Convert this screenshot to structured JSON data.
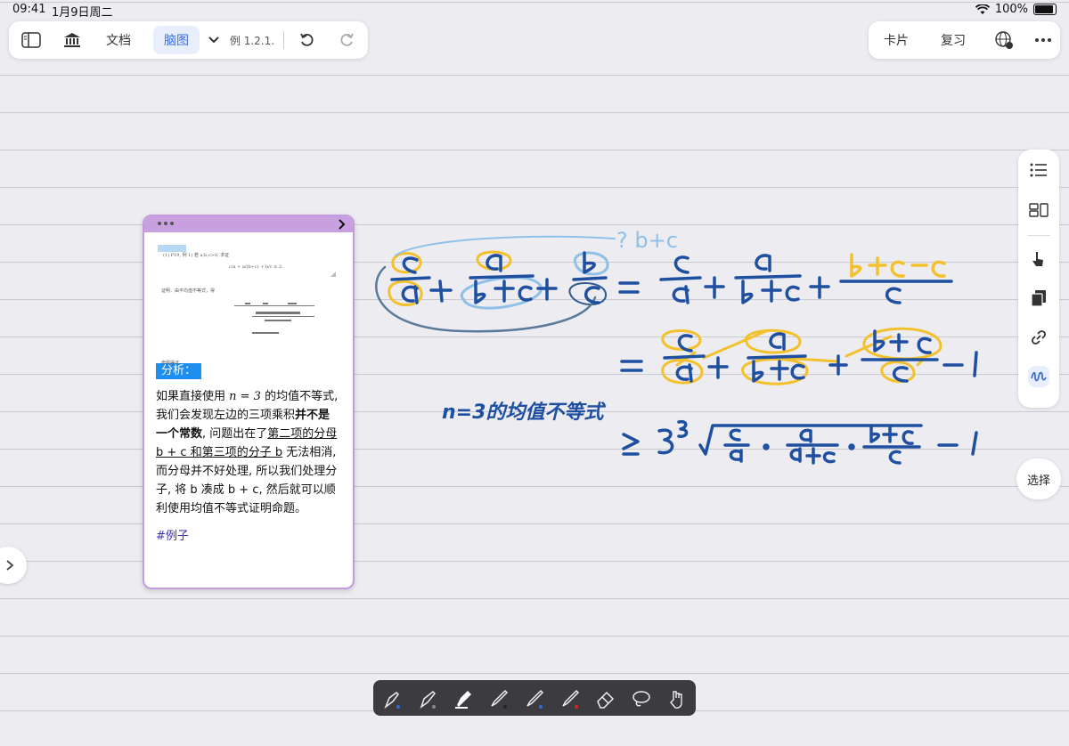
{
  "status_bar": {
    "time": "09:41",
    "date": "1月9日周二",
    "battery": "100%"
  },
  "toolbar_left": {
    "sidebar_icon": "sidebar-icon",
    "library_icon": "library-icon",
    "doc_label": "文档",
    "mindmap_label": "脑图",
    "title": "例 1.2.1.",
    "undo_icon": "undo-icon",
    "redo_icon": "redo-icon"
  },
  "toolbar_right": {
    "card_label": "卡片",
    "review_label": "复习",
    "www_icon": "www-icon",
    "more_icon": "more-icon"
  },
  "side_panel": {
    "icons": [
      "outline-icon",
      "layout-icon",
      "pointer-icon",
      "pages-icon",
      "link-icon",
      "pen-icon"
    ]
  },
  "select_label": "选择",
  "card": {
    "snippet_lines": [
      "(1) P19, 例 1) 若 a,b,c>0, 求证",
      "c/a + a/(b+c) + b/c ≥ 2.",
      "证明．由平均值不等式，得",
      "命题得证."
    ],
    "analysis_label": "分析：",
    "paragraph_runs": [
      {
        "text": "如果直接使用 ",
        "style": "normal"
      },
      {
        "text": "n = 3",
        "style": "math"
      },
      {
        "text": " 的均值不等式, 我们会发现左边的三项乘积",
        "style": "normal"
      },
      {
        "text": "并不是一个常数",
        "style": "bold"
      },
      {
        "text": ", 问题出在了",
        "style": "normal"
      },
      {
        "text": "第二项的分母 b + c 和第三项的分子 b",
        "style": "underline"
      },
      {
        "text": " 无法相消, 而分母并不好处理, 所以我们处理分子, 将 b 凑成 b + c, 然后就可以顺利使用均值不等式证明命题。",
        "style": "normal"
      }
    ],
    "tag": "#例子"
  },
  "handwriting": {
    "note": "? b+c",
    "eq1_lhs": [
      "c/a",
      "a/(b+c)",
      "b/c"
    ],
    "eq1_rhs": [
      "c/a",
      "a/(b+c)",
      "(b+c-c)/c"
    ],
    "eq2": [
      "c/a",
      "a/(b+c)",
      "(b+c)/c",
      "-1"
    ],
    "label": "n=3的均值不等式",
    "eq3": "≥ 3∛(c/a · a/(a+c) · (b+c)/c) - 1"
  },
  "bottom_tools": [
    "fountain-pen-icon",
    "ballpoint-pen-icon",
    "highlighter-icon",
    "pencil-black-icon",
    "pencil-blue-icon",
    "pencil-red-icon",
    "eraser-icon",
    "lasso-icon",
    "hand-tool-icon"
  ],
  "colors": {
    "ink": "#1f4fa0",
    "highlight": "#f3c12c",
    "blue_circle": "#8fc0e8",
    "card_border": "#c59be0",
    "accent": "#3b6fd8"
  }
}
